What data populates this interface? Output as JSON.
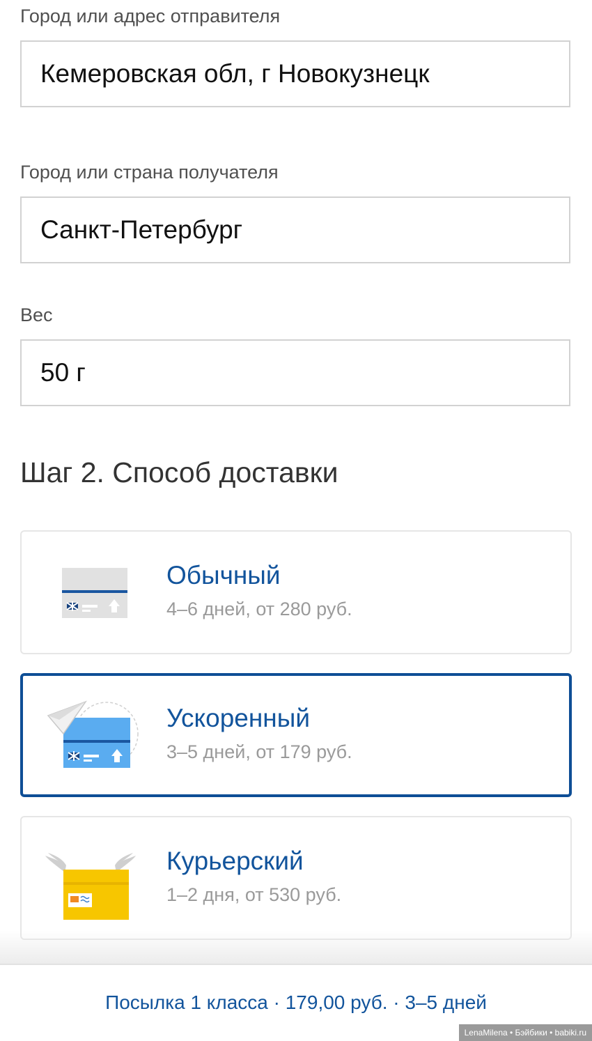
{
  "sender": {
    "label": "Город или адрес отправителя",
    "value": "Кемеровская обл, г Новокузнецк"
  },
  "recipient": {
    "label": "Город или страна получателя",
    "value": "Санкт-Петербург"
  },
  "weight": {
    "label": "Вес",
    "value": "50 г"
  },
  "step2": {
    "title": "Шаг 2. Способ доставки"
  },
  "delivery_options": [
    {
      "title": "Обычный",
      "subtitle": "4–6 дней, от 280 руб.",
      "icon": "regular-envelope-icon",
      "selected": false
    },
    {
      "title": "Ускоренный",
      "subtitle": "3–5 дней, от 179 руб.",
      "icon": "paper-plane-envelope-icon",
      "selected": true
    },
    {
      "title": "Курьерский",
      "subtitle": "1–2 дня, от 530 руб.",
      "icon": "winged-box-icon",
      "selected": false
    }
  ],
  "summary": {
    "text": "Посылка 1 класса · 179,00 руб. · 3–5 дней"
  },
  "watermark": {
    "text": "LenaMilena • Бэйбики • babiki.ru"
  },
  "colors": {
    "accent": "#12549c",
    "selected_border": "#0e4e96",
    "courier_yellow": "#f7c600",
    "express_blue": "#5aacf0"
  }
}
